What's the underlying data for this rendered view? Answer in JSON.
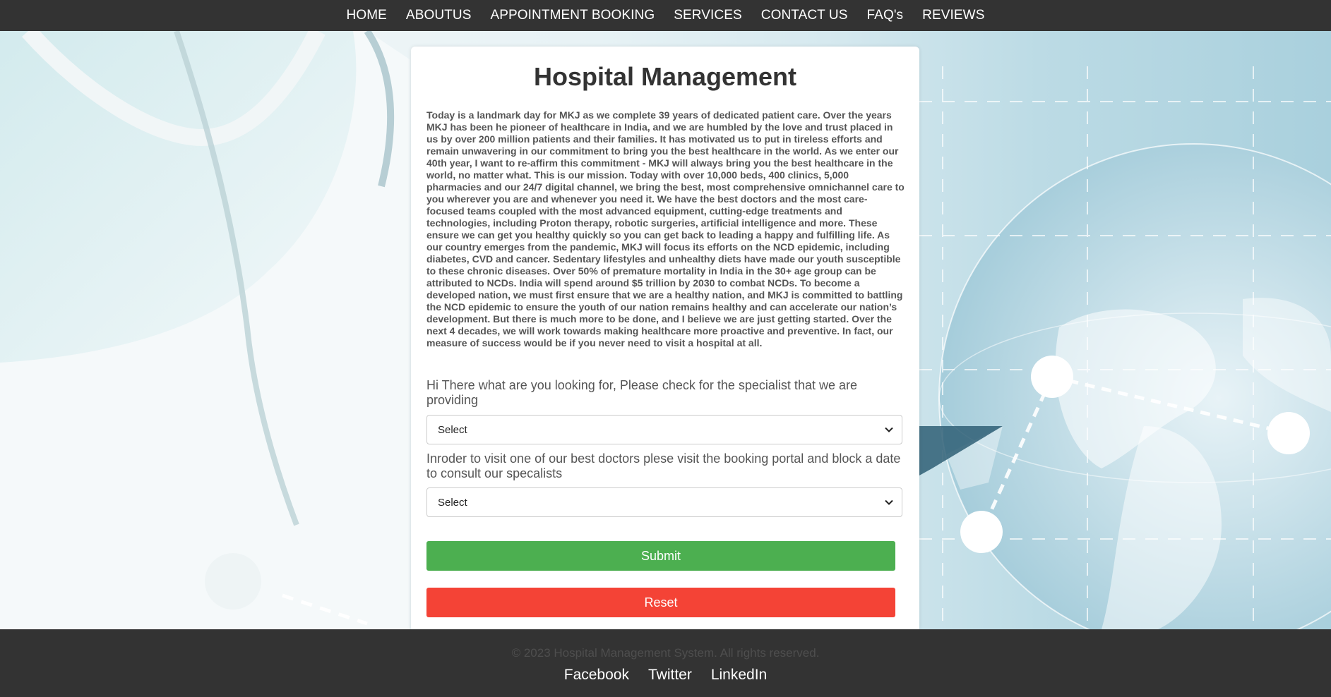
{
  "nav": {
    "items": [
      {
        "label": "HOME"
      },
      {
        "label": "ABOUTUS"
      },
      {
        "label": "APPOINTMENT BOOKING"
      },
      {
        "label": "SERVICES"
      },
      {
        "label": "CONTACT US"
      },
      {
        "label": "FAQ's"
      },
      {
        "label": "REVIEWS"
      }
    ]
  },
  "main": {
    "title": "Hospital Management",
    "paragraph": "Today is a landmark day for MKJ as we complete 39 years of dedicated patient care. Over the years MKJ has been he pioneer of healthcare in India, and we are humbled by the love and trust placed in us by over 200 million patients and their families. It has motivated us to put in tireless efforts and remain unwavering in our commitment to bring you the best healthcare in the world. As we enter our 40th year, I want to re-affirm this commitment - MKJ will always bring you the best healthcare in the world, no matter what. This is our mission. Today with over 10,000 beds, 400 clinics, 5,000 pharmacies and our 24/7 digital channel, we bring the best, most comprehensive omnichannel care to you wherever you are and whenever you need it. We have the best doctors and the most care-focused teams coupled with the most advanced equipment, cutting-edge treatments and technologies, including Proton therapy, robotic surgeries, artificial intelligence and more. These ensure we can get you healthy quickly so you can get back to leading a happy and fulfilling life. As our country emerges from the pandemic, MKJ will focus its efforts on the NCD epidemic, including diabetes, CVD and cancer. Sedentary lifestyles and unhealthy diets have made our youth susceptible to these chronic diseases. Over 50% of premature mortality in India in the 30+ age group can be attributed to NCDs. India will spend around $5 trillion by 2030 to combat NCDs. To become a developed nation, we must first ensure that we are a healthy nation, and MKJ is committed to battling the NCD epidemic to ensure the youth of our nation remains healthy and can accelerate our nation’s development. But there is much more to be done, and I believe we are just getting started. Over the next 4 decades, we will work towards making healthcare more proactive and preventive. In fact, our measure of success would be if you never need to visit a hospital at all.",
    "question1": "Hi There what are you looking for, Please check for the specialist that we are providing",
    "select1": {
      "value": "Select"
    },
    "question2": "Inroder to visit one of our best doctors plese visit the booking portal and block a date to consult our specalists",
    "select2": {
      "value": "Select"
    },
    "submit_label": "Submit",
    "reset_label": "Reset"
  },
  "footer": {
    "copyright": "© 2023 Hospital Management System. All rights reserved.",
    "links": [
      {
        "label": "Facebook"
      },
      {
        "label": "Twitter"
      },
      {
        "label": "LinkedIn"
      }
    ]
  },
  "colors": {
    "nav_bg": "#333333",
    "submit": "#4caf50",
    "reset": "#f44336",
    "footer_bg": "#333333"
  },
  "icons": {
    "select_arrow": "chevron-down-icon"
  }
}
